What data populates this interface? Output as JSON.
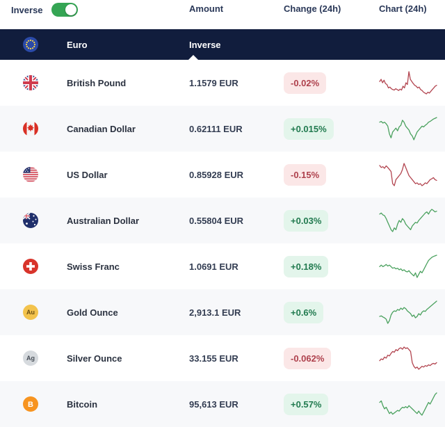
{
  "colors": {
    "navy_header": "#111d3d",
    "toggle_on_green": "#35a554",
    "positive_badge_bg": "#e3f5eb",
    "positive_badge_text": "#217a4f",
    "negative_badge_bg": "#fbe7e7",
    "negative_badge_text": "#ae414d",
    "spark_up": "#4aa15e",
    "spark_down": "#b2444f"
  },
  "toolbar": {
    "inverse_label": "Inverse",
    "inverse_toggle_state": "on"
  },
  "columns": {
    "amount": "Amount",
    "change": "Change (24h)",
    "chart": "Chart (24h)"
  },
  "group_header": {
    "name": "Euro",
    "icon": "eu-flag-icon",
    "amount_column_label": "Inverse"
  },
  "rows": [
    {
      "name": "British Pound",
      "icon": "gb-flag-icon",
      "icon_text": "",
      "amount": "1.1579 EUR",
      "change": "-0.02%",
      "direction": "down",
      "spark": [
        55,
        60,
        52,
        58,
        50,
        48,
        40,
        42,
        38,
        36,
        35,
        38,
        36,
        34,
        37,
        35,
        44,
        40,
        52,
        48,
        78,
        60,
        55,
        50,
        46,
        44,
        40,
        42,
        36,
        34,
        30,
        28,
        26,
        30,
        28,
        32,
        36,
        40,
        44,
        46
      ]
    },
    {
      "name": "Canadian Dollar",
      "icon": "ca-flag-icon",
      "icon_text": "",
      "amount": "0.62111 EUR",
      "change": "+0.015%",
      "direction": "up",
      "spark": [
        70,
        72,
        68,
        70,
        66,
        60,
        40,
        30,
        45,
        50,
        55,
        48,
        58,
        62,
        75,
        70,
        60,
        55,
        50,
        40,
        35,
        25,
        35,
        45,
        50,
        55,
        60,
        58,
        62,
        65,
        70,
        72,
        75,
        78,
        80,
        82
      ]
    },
    {
      "name": "US Dollar",
      "icon": "us-flag-icon",
      "icon_text": "",
      "amount": "0.85928 EUR",
      "change": "-0.15%",
      "direction": "down",
      "spark": [
        75,
        70,
        72,
        68,
        74,
        70,
        65,
        60,
        30,
        25,
        40,
        45,
        50,
        55,
        65,
        80,
        70,
        60,
        50,
        45,
        40,
        35,
        30,
        32,
        28,
        30,
        25,
        28,
        32,
        30,
        35,
        40,
        42,
        45,
        40,
        38
      ]
    },
    {
      "name": "Australian Dollar",
      "icon": "au-flag-icon",
      "icon_text": "",
      "amount": "0.55804 EUR",
      "change": "+0.03%",
      "direction": "up",
      "spark": [
        72,
        75,
        70,
        68,
        60,
        50,
        40,
        30,
        25,
        35,
        30,
        45,
        55,
        50,
        60,
        55,
        45,
        40,
        35,
        30,
        40,
        45,
        50,
        48,
        55,
        60,
        65,
        70,
        75,
        78,
        72,
        80,
        85,
        82,
        78,
        80
      ]
    },
    {
      "name": "Swiss Franc",
      "icon": "ch-flag-icon",
      "icon_text": "",
      "amount": "1.0691 EUR",
      "change": "+0.18%",
      "direction": "up",
      "spark": [
        55,
        60,
        55,
        58,
        62,
        57,
        60,
        55,
        50,
        52,
        48,
        50,
        45,
        48,
        42,
        45,
        40,
        38,
        42,
        35,
        30,
        25,
        35,
        20,
        30,
        40,
        35,
        45,
        55,
        65,
        75,
        80,
        85,
        88,
        90,
        92
      ]
    },
    {
      "name": "Gold Ounce",
      "icon": "gold-icon",
      "icon_text": "Au",
      "amount": "2,913.1 EUR",
      "change": "+0.6%",
      "direction": "up",
      "spark": [
        40,
        42,
        38,
        35,
        30,
        15,
        25,
        45,
        55,
        60,
        58,
        65,
        62,
        70,
        65,
        72,
        68,
        60,
        55,
        50,
        40,
        45,
        35,
        40,
        50,
        45,
        55,
        60,
        58,
        65,
        70,
        75,
        80,
        85,
        90,
        95
      ]
    },
    {
      "name": "Silver Ounce",
      "icon": "silver-icon",
      "icon_text": "Ag",
      "amount": "33.155 EUR",
      "change": "-0.062%",
      "direction": "down",
      "spark": [
        45,
        50,
        48,
        55,
        52,
        60,
        58,
        65,
        70,
        68,
        75,
        72,
        78,
        80,
        76,
        82,
        78,
        80,
        75,
        70,
        40,
        30,
        25,
        28,
        22,
        26,
        30,
        28,
        32,
        30,
        34,
        32,
        36,
        38,
        36,
        40
      ]
    },
    {
      "name": "Bitcoin",
      "icon": "btc-icon",
      "icon_text": "B",
      "amount": "95,613 EUR",
      "change": "+0.57%",
      "direction": "up",
      "spark": [
        65,
        70,
        55,
        45,
        50,
        40,
        30,
        35,
        28,
        32,
        36,
        40,
        38,
        45,
        50,
        48,
        52,
        48,
        55,
        50,
        45,
        40,
        35,
        30,
        38,
        30,
        25,
        35,
        45,
        55,
        65,
        60,
        70,
        80,
        90,
        95
      ]
    }
  ]
}
